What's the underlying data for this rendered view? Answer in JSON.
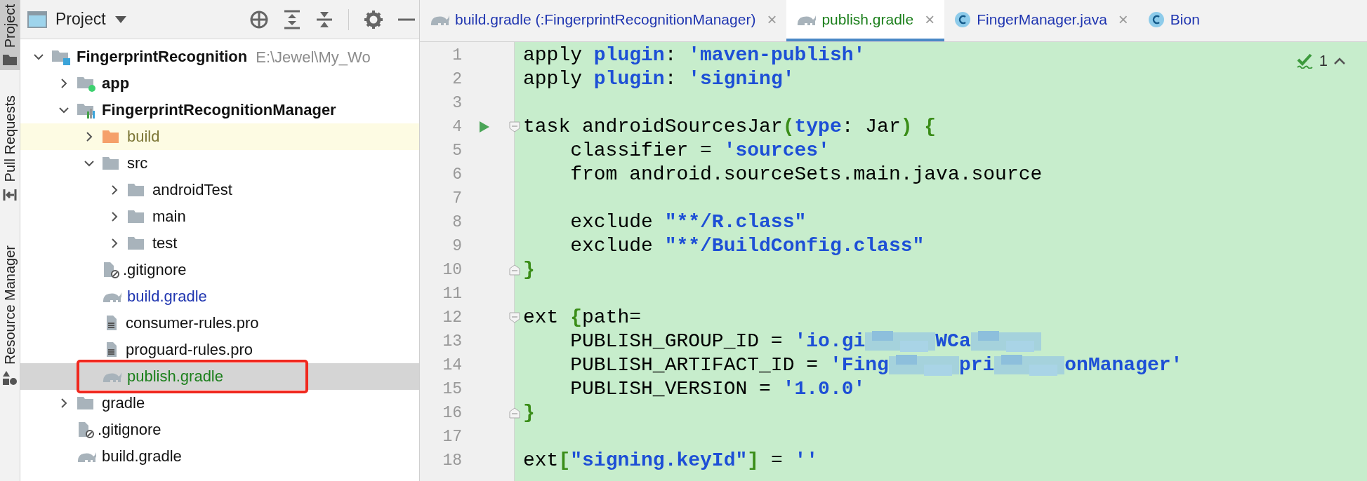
{
  "side_strip": [
    {
      "label": "Project",
      "selected": true,
      "kind": "folder"
    },
    {
      "label": "Pull Requests",
      "selected": false,
      "kind": "pull"
    },
    {
      "label": "Resource Manager",
      "selected": false,
      "kind": "resources"
    }
  ],
  "project_panel": {
    "title": "Project",
    "tree": [
      {
        "label": "FingerprintRecognition",
        "path": "E:\\Jewel\\My_Wo",
        "kind": "project",
        "expanded": true,
        "selected": false,
        "children": [
          {
            "label": "app",
            "kind": "app-module",
            "expanded": false,
            "selected": false
          },
          {
            "label": "FingerprintRecognitionManager",
            "kind": "library-module",
            "expanded": true,
            "selected": false,
            "children": [
              {
                "label": "build",
                "kind": "excluded-folder",
                "expanded": false,
                "selected": false
              },
              {
                "label": "src",
                "kind": "folder",
                "expanded": true,
                "selected": false,
                "children": [
                  {
                    "label": "androidTest",
                    "kind": "folder",
                    "expanded": false,
                    "selected": false
                  },
                  {
                    "label": "main",
                    "kind": "folder",
                    "expanded": false,
                    "selected": false
                  },
                  {
                    "label": "test",
                    "kind": "folder",
                    "expanded": false,
                    "selected": false
                  }
                ]
              },
              {
                "label": ".gitignore",
                "kind": "ignore-file",
                "selected": false
              },
              {
                "label": "build.gradle",
                "kind": "gradle-file",
                "color": "#1f35b0",
                "selected": false
              },
              {
                "label": "consumer-rules.pro",
                "kind": "text-file",
                "selected": false
              },
              {
                "label": "proguard-rules.pro",
                "kind": "text-file",
                "selected": false
              },
              {
                "label": "publish.gradle",
                "kind": "gradle-file",
                "color": "#1b7f1b",
                "selected": true,
                "outlined": true
              }
            ]
          },
          {
            "label": "gradle",
            "kind": "folder",
            "expanded": false,
            "selected": false
          },
          {
            "label": ".gitignore",
            "kind": "ignore-file",
            "selected": false
          },
          {
            "label": "build.gradle",
            "kind": "gradle-file",
            "selected": false
          }
        ]
      }
    ]
  },
  "tabs": [
    {
      "label": "build.gradle (:FingerprintRecognitionManager)",
      "kind": "gradle",
      "color": "#1f35b0",
      "selected": false,
      "close": "×"
    },
    {
      "label": "publish.gradle",
      "kind": "gradle",
      "color": "#1b7f1b",
      "selected": true,
      "close": "×"
    },
    {
      "label": "FingerManager.java",
      "kind": "class",
      "color": "#1f35b0",
      "selected": false,
      "close": "×"
    },
    {
      "label": "Bion",
      "kind": "class",
      "color": "#1f35b0",
      "selected": false
    }
  ],
  "inspection": {
    "count": "1"
  },
  "code_lines": [
    {
      "number": "1",
      "tokens": [
        {
          "text": "apply "
        },
        {
          "text": "plugin",
          "color": "#1d4fd6"
        },
        {
          "text": ": "
        },
        {
          "text": "'maven-publish'",
          "color": "#1d4fd6"
        }
      ]
    },
    {
      "number": "2",
      "tokens": [
        {
          "text": "apply "
        },
        {
          "text": "plugin",
          "color": "#1d4fd6"
        },
        {
          "text": ": "
        },
        {
          "text": "'signing'",
          "color": "#1d4fd6"
        }
      ]
    },
    {
      "number": "3"
    },
    {
      "number": "4",
      "run": true,
      "fold_start": true,
      "tokens": [
        {
          "text": "task androidSourcesJar"
        },
        {
          "text": "(",
          "color": "#3a8d18"
        },
        {
          "text": "type",
          "color": "#1d4fd6"
        },
        {
          "text": ": Jar"
        },
        {
          "text": ") {",
          "color": "#3a8d18"
        }
      ]
    },
    {
      "number": "5",
      "tokens": [
        {
          "text": "    classifier = "
        },
        {
          "text": "'sources'",
          "color": "#1d4fd6"
        }
      ]
    },
    {
      "number": "6",
      "tokens": [
        {
          "text": "    from android.sourceSets.main.java.source"
        }
      ]
    },
    {
      "number": "7"
    },
    {
      "number": "8",
      "tokens": [
        {
          "text": "    exclude "
        },
        {
          "text": "\"**/R.class\"",
          "color": "#1d4fd6"
        }
      ]
    },
    {
      "number": "9",
      "tokens": [
        {
          "text": "    exclude "
        },
        {
          "text": "\"**/BuildConfig.class\"",
          "color": "#1d4fd6"
        }
      ]
    },
    {
      "number": "10",
      "fold_end": true,
      "tokens": [
        {
          "text": "}",
          "color": "#3a8d18"
        }
      ]
    },
    {
      "number": "11"
    },
    {
      "number": "12",
      "fold_start": true,
      "tokens": [
        {
          "text": "ext "
        },
        {
          "text": "{",
          "color": "#3a8d18"
        },
        {
          "text": "path="
        }
      ]
    },
    {
      "number": "13",
      "tokens": [
        {
          "text": "    PUBLISH_GROUP_ID = "
        },
        {
          "text": "'io.gi",
          "color": "#1d4fd6"
        },
        {
          "kind": "redacted"
        },
        {
          "text": "WCa",
          "color": "#1d4fd6"
        },
        {
          "kind": "redacted"
        }
      ]
    },
    {
      "number": "14",
      "tokens": [
        {
          "text": "    PUBLISH_ARTIFACT_ID = "
        },
        {
          "text": "'Fing",
          "color": "#1d4fd6"
        },
        {
          "kind": "redacted"
        },
        {
          "text": "pri",
          "color": "#1d4fd6"
        },
        {
          "kind": "redacted"
        },
        {
          "text": "onManager'",
          "color": "#1d4fd6"
        }
      ]
    },
    {
      "number": "15",
      "tokens": [
        {
          "text": "    PUBLISH_VERSION = "
        },
        {
          "text": "'1.0.0'",
          "color": "#1d4fd6"
        }
      ]
    },
    {
      "number": "16",
      "fold_end": true,
      "tokens": [
        {
          "text": "}",
          "color": "#3a8d18"
        }
      ]
    },
    {
      "number": "17"
    },
    {
      "number": "18",
      "tokens": [
        {
          "text": "ext"
        },
        {
          "text": "[",
          "color": "#3a8d18"
        },
        {
          "text": "\"signing.keyId\"",
          "color": "#1d4fd6"
        },
        {
          "text": "]",
          "color": "#3a8d18"
        },
        {
          "text": " = "
        },
        {
          "text": "''",
          "color": "#1d4fd6"
        }
      ]
    }
  ]
}
